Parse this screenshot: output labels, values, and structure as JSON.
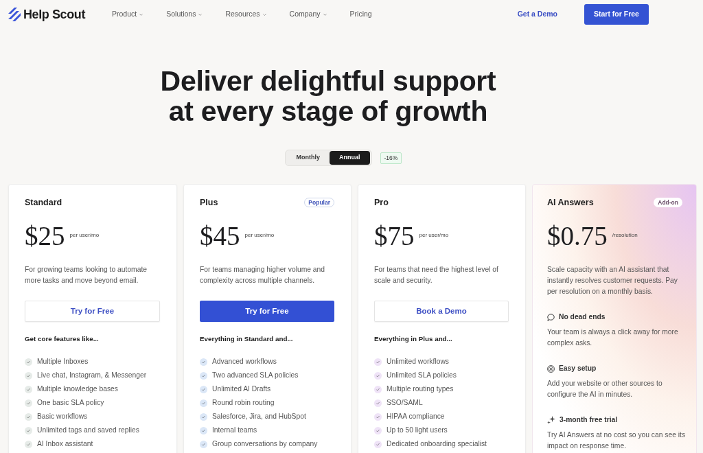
{
  "nav": {
    "logo": "Help Scout",
    "menu": [
      {
        "label": "Product",
        "dropdown": true
      },
      {
        "label": "Solutions",
        "dropdown": true
      },
      {
        "label": "Resources",
        "dropdown": true
      },
      {
        "label": "Company",
        "dropdown": true
      },
      {
        "label": "Pricing",
        "dropdown": false
      }
    ],
    "demo_link": "Get a Demo",
    "cta_button": "Start for Free"
  },
  "hero": {
    "headline": "Deliver delightful support at every stage of growth"
  },
  "billing_toggle": {
    "options": [
      {
        "label": "Monthly",
        "selected": false
      },
      {
        "label": "Annual",
        "selected": true
      }
    ],
    "discount": "-16%"
  },
  "plans": [
    {
      "kind": "tier",
      "name": "Standard",
      "price": "$25",
      "unit": "per user/mo",
      "description": "For growing teams looking to automate more tasks and move beyond email.",
      "button": {
        "label": "Try for Free",
        "primary": false
      },
      "features_heading": "Get core features like...",
      "color": "#e6ebe8",
      "features": [
        "Multiple Inboxes",
        "Live chat, Instagram, & Messenger",
        "Multiple knowledge bases",
        "One basic SLA policy",
        "Basic workflows",
        "Unlimited tags and saved replies",
        "AI Inbox assistant"
      ]
    },
    {
      "kind": "tier",
      "name": "Plus",
      "badge": "Popular",
      "price": "$45",
      "unit": "per user/mo",
      "description": "For teams managing higher volume and complexity across multiple channels.",
      "button": {
        "label": "Try for Free",
        "primary": true
      },
      "features_heading": "Everything in Standard and...",
      "color": "#dbe7f7",
      "features": [
        "Advanced workflows",
        "Two advanced SLA policies",
        "Unlimited AI Drafts",
        "Round robin routing",
        "Salesforce, Jira, and HubSpot",
        "Internal teams",
        "Group conversations by company"
      ]
    },
    {
      "kind": "tier",
      "name": "Pro",
      "price": "$75",
      "unit": "per user/mo",
      "description": "For teams that need the highest level of scale and security.",
      "button": {
        "label": "Book a Demo",
        "primary": false
      },
      "features_heading": "Everything in Plus and...",
      "color": "#efe3f7",
      "features": [
        "Unlimited workflows",
        "Unlimited SLA policies",
        "Multiple routing types",
        "SSO/SAML",
        "HIPAA compliance",
        "Up to 50 light users",
        "Dedicated onboarding specialist"
      ]
    },
    {
      "kind": "addon",
      "name": "AI Answers",
      "badge": "Add-on",
      "price": "$0.75",
      "unit": "/resolution",
      "description": "Scale capacity with an AI assistant that instantly resolves customer requests. Pay per resolution on a monthly basis.",
      "highlights": [
        {
          "title": "No dead ends",
          "text": "Your team is always a click away for more complex asks."
        },
        {
          "title": "Easy setup",
          "text": "Add your website or other sources to configure the AI in minutes."
        },
        {
          "title": "3-month free trial",
          "text": "Try AI Answers at no cost so you can see its impact on response time."
        }
      ]
    }
  ]
}
